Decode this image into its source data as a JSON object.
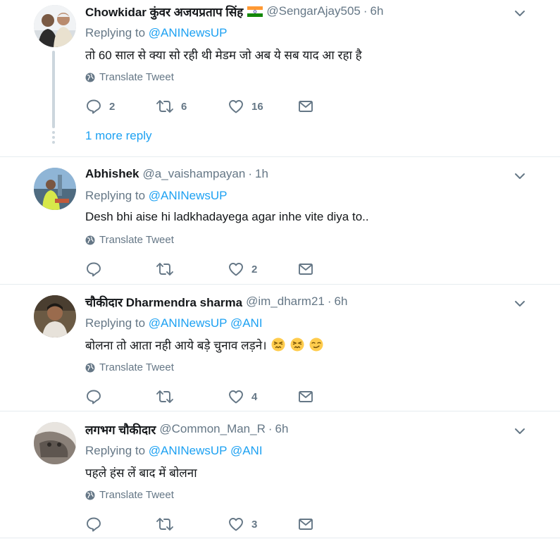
{
  "tweets": [
    {
      "name": "Chowkidar कुंवर अजयप्रताप सिंह",
      "handle": "@SengarAjay505",
      "separator": "·",
      "time": "6h",
      "replying_label": "Replying to",
      "replying_to": "@ANINewsUP",
      "replying_to_2": "",
      "text": "तो 60 साल से क्या सो रही थी मेडम जो अब ये सब याद आ रहा है",
      "translate": "Translate Tweet",
      "reply_count": "2",
      "retweet_count": "6",
      "like_count": "16",
      "more_reply": "1 more reply"
    },
    {
      "name": "Abhishek",
      "handle": "@a_vaishampayan",
      "separator": "·",
      "time": "1h",
      "replying_label": "Replying to",
      "replying_to": "@ANINewsUP",
      "replying_to_2": "",
      "text": "Desh bhi aise hi ladkhadayega agar inhe vite diya to..",
      "translate": "Translate Tweet",
      "reply_count": "",
      "retweet_count": "",
      "like_count": "2"
    },
    {
      "name": "चौकीदार Dharmendra sharma",
      "handle": "@im_dharm21",
      "separator": "·",
      "time": "6h",
      "replying_label": "Replying to",
      "replying_to": "@ANINewsUP",
      "replying_to_2": "@ANI",
      "text": "बोलना तो आता नही आये बड़े चुनाव लड़ने।",
      "translate": "Translate Tweet",
      "reply_count": "",
      "retweet_count": "",
      "like_count": "4"
    },
    {
      "name": "लगभग चौकीदार",
      "handle": "@Common_Man_R",
      "separator": "·",
      "time": "6h",
      "replying_label": "Replying to",
      "replying_to": "@ANINewsUP",
      "replying_to_2": "@ANI",
      "text": "पहले हंस लें बाद में बोलना",
      "translate": "Translate Tweet",
      "reply_count": "",
      "retweet_count": "",
      "like_count": "3"
    }
  ],
  "colors": {
    "link": "#1da1f2",
    "muted": "#657786",
    "divider": "#e6ecf0",
    "thread_line": "#ccd6dd"
  },
  "icons": [
    "chevron-down-icon",
    "globe-icon",
    "reply-icon",
    "retweet-icon",
    "like-icon",
    "message-icon",
    "india-flag-icon",
    "persevering-face-emoji",
    "smirk-face-emoji"
  ]
}
